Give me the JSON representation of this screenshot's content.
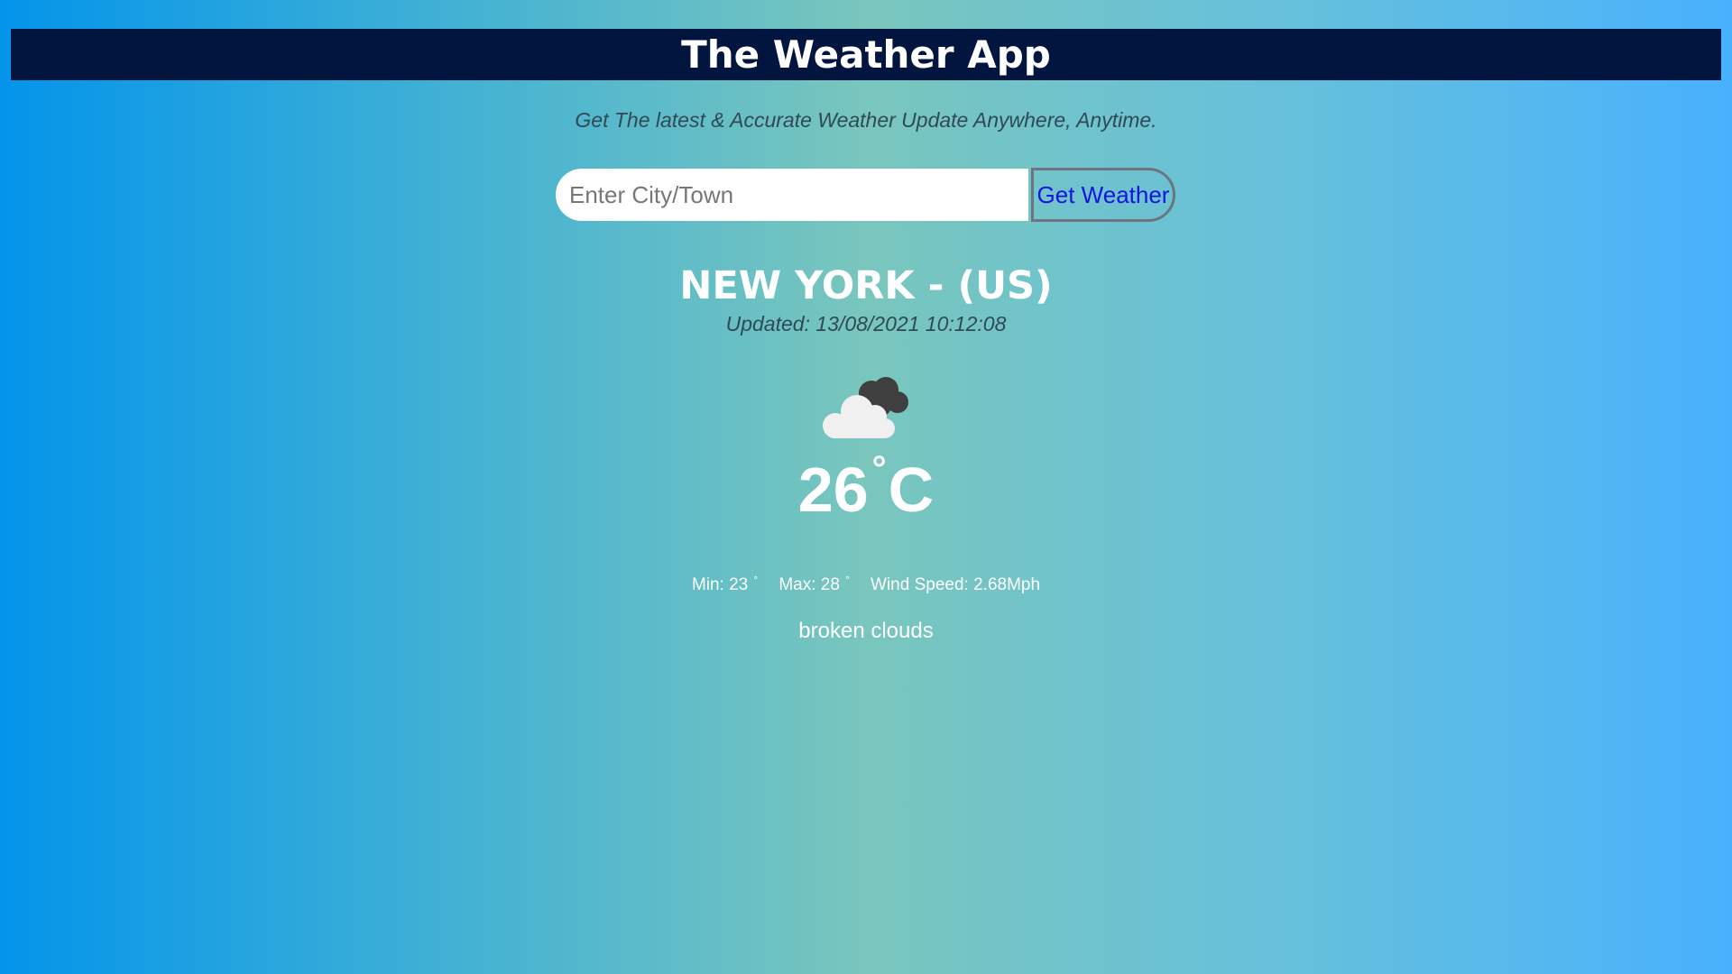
{
  "header": {
    "title": "The Weather App"
  },
  "tagline": "Get The latest & Accurate Weather Update Anywhere, Anytime.",
  "search": {
    "placeholder": "Enter City/Town",
    "value": "",
    "button_label": "Get Weather"
  },
  "weather": {
    "location": "NEW YORK - (US)",
    "updated": "Updated: 13/08/2021 10:12:08",
    "icon": "broken-clouds-icon",
    "temp_value": "26",
    "temp_degree": "°",
    "temp_unit": "C",
    "min_label": "Min: 23",
    "max_label": "Max: 28",
    "degree_symbol": "°",
    "wind_label": "Wind Speed: 2.68Mph",
    "description": "broken clouds"
  },
  "colors": {
    "header_bg": "#02153f",
    "button_text": "#1414e0",
    "muted_text": "#2f4a55"
  }
}
